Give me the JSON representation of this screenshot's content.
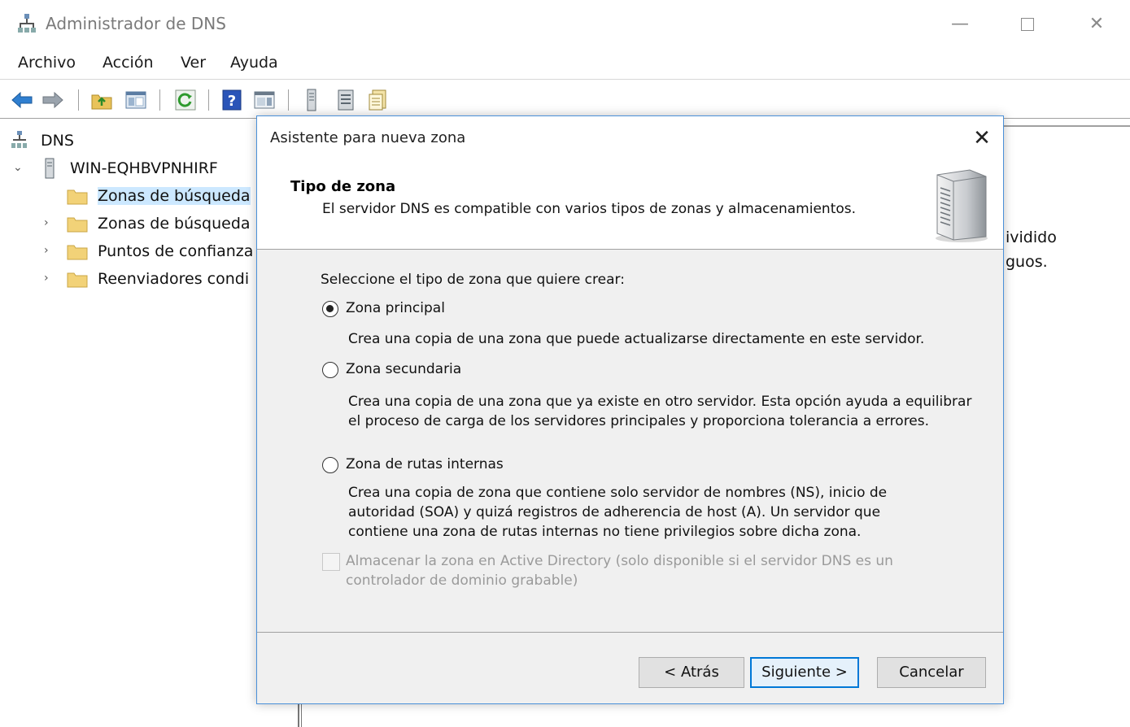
{
  "window": {
    "title": "Administrador de DNS",
    "controls": {
      "minimize": "—",
      "close": "✕"
    }
  },
  "menu": [
    "Archivo",
    "Acción",
    "Ver",
    "Ayuda"
  ],
  "toolbar": {
    "icons": [
      "back-arrow-icon",
      "forward-arrow-icon",
      "up-folder-icon",
      "show-tree-icon",
      "refresh-icon",
      "help-icon",
      "view-icon",
      "server-icon",
      "list-icon",
      "properties-icon"
    ]
  },
  "tree": {
    "root": "DNS",
    "server": "WIN-EQHBVPNHIRF",
    "items": [
      {
        "label": "Zonas de búsqueda"
      },
      {
        "label": "Zonas de búsqueda"
      },
      {
        "label": "Puntos de confianza"
      },
      {
        "label": "Reenviadores condi"
      }
    ]
  },
  "right_pane": {
    "line1": "ividido",
    "line2": "guos."
  },
  "dialog": {
    "title": "Asistente para nueva zona",
    "close": "✕",
    "header_title": "Tipo de zona",
    "header_subtitle": "El servidor DNS es compatible con varios tipos de zonas y almacenamientos.",
    "prompt": "Seleccione el tipo de zona que quiere crear:",
    "options": [
      {
        "label": "Zona principal",
        "checked": true,
        "description": "Crea una copia de una zona que puede actualizarse directamente en este servidor."
      },
      {
        "label": "Zona secundaria",
        "checked": false,
        "description": "Crea una copia de una zona que ya existe en otro servidor. Esta opción ayuda a equilibrar el proceso de carga de los servidores principales y proporciona tolerancia a errores."
      },
      {
        "label": "Zona de rutas internas",
        "checked": false,
        "description": "Crea una copia de zona que contiene solo servidor de nombres (NS), inicio de autoridad (SOA) y quizá registros de adherencia de host (A). Un servidor que contiene una zona de rutas internas no tiene privilegios sobre dicha zona."
      }
    ],
    "checkbox": {
      "label": "Almacenar la zona en Active Directory (solo disponible si el servidor DNS es un controlador de dominio grabable)",
      "checked": false,
      "enabled": false
    },
    "buttons": {
      "back": "< Atrás",
      "next": "Siguiente >",
      "cancel": "Cancelar"
    }
  },
  "colors": {
    "accent": "#0078d7",
    "selection": "#cce8ff",
    "dialog_bg": "#f0f0f0",
    "disabled_text": "#9a9a9a"
  }
}
